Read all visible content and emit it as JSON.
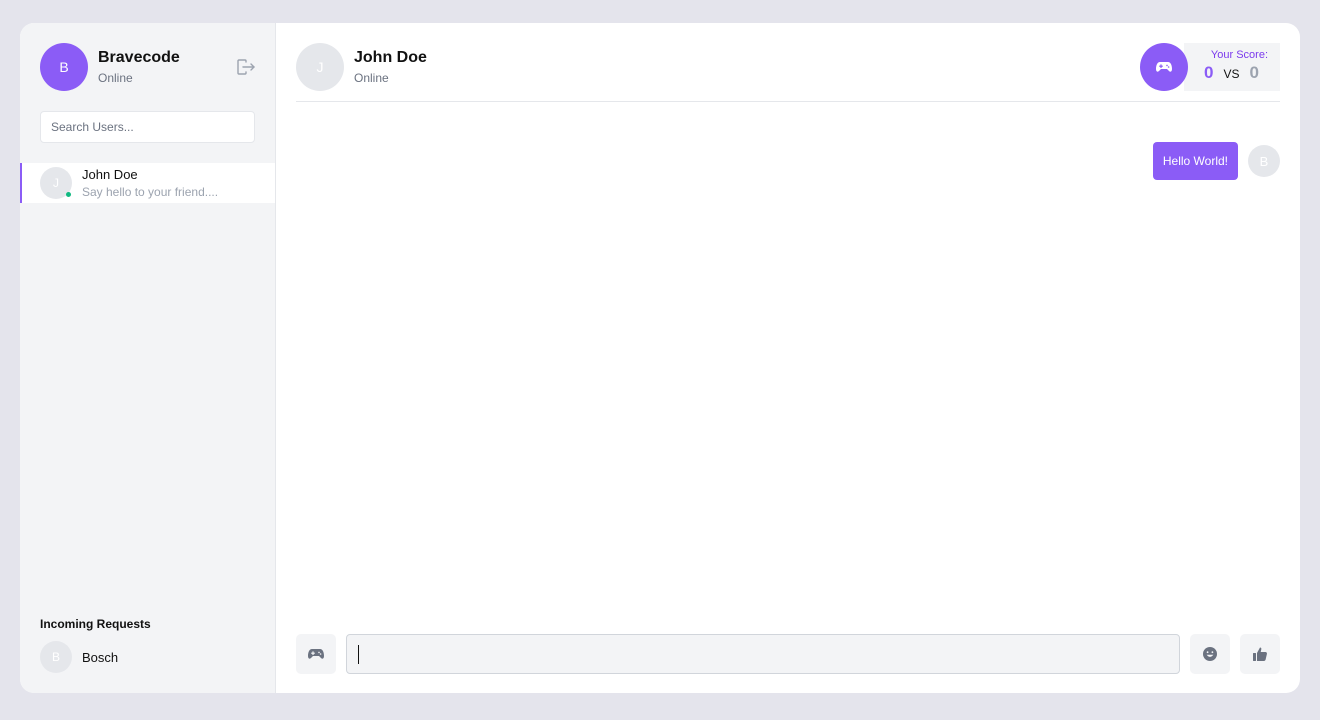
{
  "sidebar": {
    "user": {
      "initial": "B",
      "name": "Bravecode",
      "status": "Online"
    },
    "search": {
      "placeholder": "Search Users..."
    },
    "contacts": [
      {
        "initial": "J",
        "name": "John Doe",
        "preview": "Say hello to your friend....",
        "online": true
      }
    ],
    "requests": {
      "title": "Incoming Requests",
      "items": [
        {
          "initial": "B",
          "name": "Bosch"
        }
      ]
    }
  },
  "chat": {
    "peer": {
      "initial": "J",
      "name": "John Doe",
      "status": "Online"
    },
    "score": {
      "label": "Your Score:",
      "mine": "0",
      "vs": "VS",
      "theirs": "0"
    },
    "messages": [
      {
        "text": "Hello World!",
        "avatar_initial": "B"
      }
    ],
    "composer": {
      "value": ""
    }
  },
  "colors": {
    "accent": "#8b5cf6",
    "online": "#10b981",
    "sidebar_bg": "#f3f4f6",
    "page_bg": "#e4e4ec"
  },
  "icons": [
    "logout-icon",
    "gamepad-icon",
    "smiley-icon",
    "thumbs-up-icon"
  ]
}
